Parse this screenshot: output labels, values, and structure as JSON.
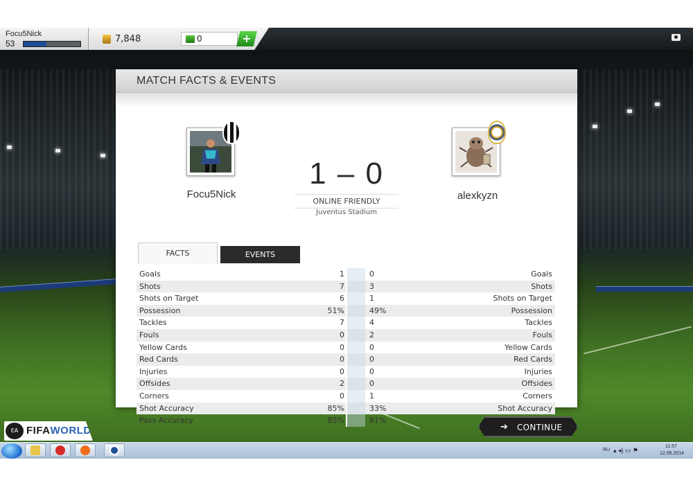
{
  "profile": {
    "name": "Focu5Nick",
    "level": "53",
    "xp_fraction": 0.4
  },
  "currency": {
    "coins": "7,848",
    "points": "0",
    "add_label": "+"
  },
  "panel": {
    "title": "MATCH FACTS & EVENTS",
    "home": {
      "name": "Focu5Nick"
    },
    "away": {
      "name": "alexkyzn"
    },
    "score": "1 – 0",
    "match_type": "ONLINE FRIENDLY",
    "venue": "Juventus Stadium",
    "tabs": [
      {
        "label": "FACTS"
      },
      {
        "label": "EVENTS"
      }
    ]
  },
  "stats": [
    {
      "label": "Goals",
      "home": "1",
      "away": "0"
    },
    {
      "label": "Shots",
      "home": "7",
      "away": "3"
    },
    {
      "label": "Shots on Target",
      "home": "6",
      "away": "1"
    },
    {
      "label": "Possession",
      "home": "51%",
      "away": "49%"
    },
    {
      "label": "Tackles",
      "home": "7",
      "away": "4"
    },
    {
      "label": "Fouls",
      "home": "0",
      "away": "2"
    },
    {
      "label": "Yellow Cards",
      "home": "0",
      "away": "0"
    },
    {
      "label": "Red Cards",
      "home": "0",
      "away": "0"
    },
    {
      "label": "Injuries",
      "home": "0",
      "away": "0"
    },
    {
      "label": "Offsides",
      "home": "2",
      "away": "0"
    },
    {
      "label": "Corners",
      "home": "0",
      "away": "1"
    },
    {
      "label": "Shot Accuracy",
      "home": "85%",
      "away": "33%"
    },
    {
      "label": "Pass Accuracy",
      "home": "85%",
      "away": "81%"
    }
  ],
  "bottom": {
    "logo_text_a": "FIFA",
    "logo_text_b": "WORLD",
    "ea_label": "EA",
    "continue_label": "CONTINUE"
  },
  "taskbar": {
    "lang": "RU",
    "time": "11:57",
    "date": "12.06.2014"
  },
  "colors": {
    "accent_blue": "#1b4e93",
    "continue_bg": "#1e1e1e",
    "coin": "#f7c640",
    "points": "#59c33e"
  }
}
